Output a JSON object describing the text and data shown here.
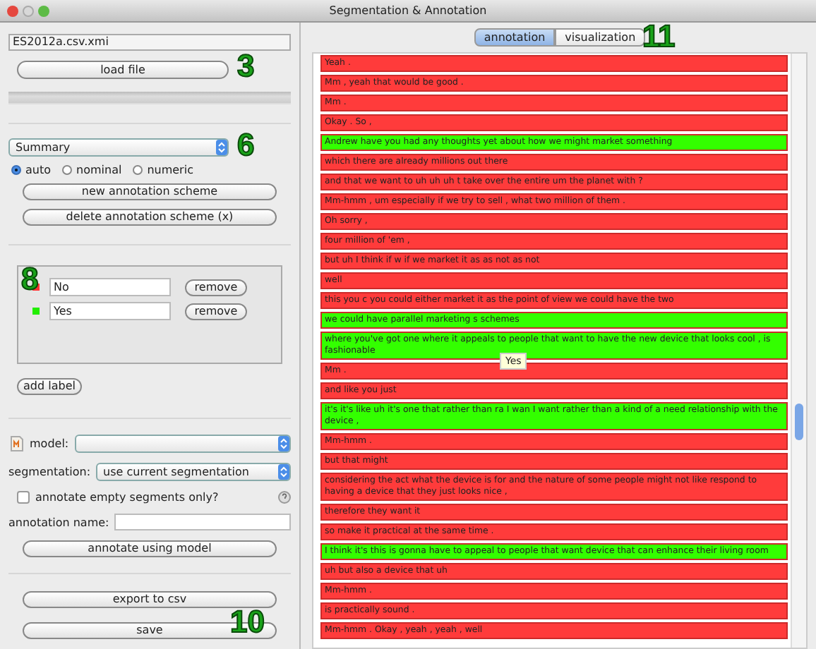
{
  "window": {
    "title": "Segmentation & Annotation"
  },
  "file": {
    "value": "ES2012a.csv.xmi"
  },
  "load_button": "load file",
  "scheme": {
    "value": "Summary"
  },
  "scheme_types": [
    {
      "label": "auto",
      "selected": true
    },
    {
      "label": "nominal",
      "selected": false
    },
    {
      "label": "numeric",
      "selected": false
    }
  ],
  "scheme_buttons": [
    "new annotation scheme",
    "delete annotation scheme (x)"
  ],
  "labels": [
    {
      "name": "No",
      "color": "#ff3333",
      "remove": "remove"
    },
    {
      "name": "Yes",
      "color": "#22ee00",
      "remove": "remove"
    }
  ],
  "add_label": "add label",
  "model": {
    "label": "model:"
  },
  "segmentation": {
    "label": "segmentation:",
    "value": "use current segmentation"
  },
  "empty_only": {
    "label": "annotate empty segments only?",
    "checked": false
  },
  "annotation_name": {
    "label": "annotation name:"
  },
  "annotate_button": "annotate using model",
  "bottom_buttons": [
    "export to csv",
    "save"
  ],
  "tabs": [
    {
      "label": "annotation",
      "selected": true
    },
    {
      "label": "visualization",
      "selected": false
    }
  ],
  "segments": [
    {
      "text": "Yeah .",
      "color": "#ff3b3b"
    },
    {
      "text": "Mm , yeah that would be good .",
      "color": "#ff3b3b"
    },
    {
      "text": "Mm .",
      "color": "#ff3b3b"
    },
    {
      "text": "Okay . So ,",
      "color": "#ff3b3b"
    },
    {
      "text": "Andrew have you had any thoughts yet about how we might market something",
      "color": "#33ff00"
    },
    {
      "text": "which there are already millions out there",
      "color": "#ff3b3b"
    },
    {
      "text": "and that we want to uh uh uh t take over the entire um the planet with ?",
      "color": "#ff3b3b"
    },
    {
      "text": "Mm-hmm , um especially if we try to sell , what two million of them .",
      "color": "#ff3b3b"
    },
    {
      "text": "Oh sorry ,",
      "color": "#ff3b3b"
    },
    {
      "text": "four million of 'em ,",
      "color": "#ff3b3b"
    },
    {
      "text": "but uh I think if w if we market it as as not as not",
      "color": "#ff3b3b"
    },
    {
      "text": "well",
      "color": "#ff3b3b"
    },
    {
      "text": "this you c you could either market it as the point of view we could have the two",
      "color": "#ff3b3b"
    },
    {
      "text": "we could have parallel marketing s schemes",
      "color": "#33ff00"
    },
    {
      "text": "where you've got one where it appeals to people that want to have the new device that looks cool , is fashionable",
      "color": "#33ff00"
    },
    {
      "text": "Mm .",
      "color": "#ff3b3b"
    },
    {
      "text": "and like you just",
      "color": "#ff3b3b"
    },
    {
      "text": "it's it's like uh it's one that rather than ra I wan I want rather than a kind of a need relationship with the device ,",
      "color": "#33ff00"
    },
    {
      "text": "Mm-hmm .",
      "color": "#ff3b3b"
    },
    {
      "text": "but that might",
      "color": "#ff3b3b"
    },
    {
      "text": "considering the act what the device is for and the nature of some people might not like respond to having a device that they just looks nice ,",
      "color": "#ff3b3b"
    },
    {
      "text": "therefore they want it",
      "color": "#ff3b3b"
    },
    {
      "text": "so make it practical at the same time .",
      "color": "#ff3b3b"
    },
    {
      "text": "I think it's this is gonna have to appeal to people that want device that can enhance their living room",
      "color": "#33ff00"
    },
    {
      "text": "uh but also a device that uh",
      "color": "#ff3b3b"
    },
    {
      "text": "Mm-hmm .",
      "color": "#ff3b3b"
    },
    {
      "text": "is practically sound .",
      "color": "#ff3b3b"
    },
    {
      "text": "Mm-hmm . Okay , yeah , yeah , well",
      "color": "#ff3b3b"
    }
  ],
  "tooltip": "Yes",
  "callouts": [
    "3",
    "6",
    "8",
    "10",
    "11"
  ]
}
